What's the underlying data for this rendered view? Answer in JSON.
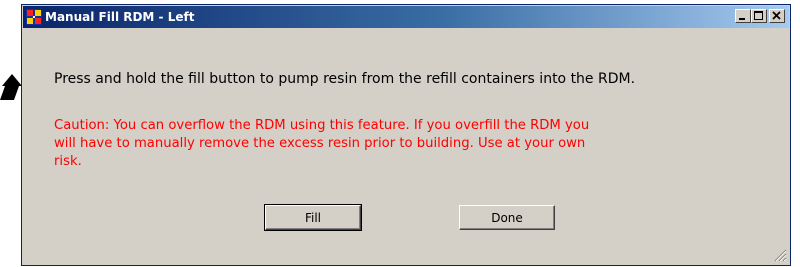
{
  "window": {
    "title": "Manual Fill RDM - Left",
    "title_bar_color": "#0a246a",
    "background_color": "#d4d0c8",
    "icon": "app-window-icon",
    "caption_buttons": {
      "minimize_icon": "minimize-icon",
      "maximize_icon": "maximize-icon",
      "close_icon": "close-icon"
    }
  },
  "dialog": {
    "instruction": "Press and hold the fill button to pump resin from the refill containers into the RDM.",
    "caution_lines": [
      "Caution: You can overflow the RDM using this feature.  If you overfill the RDM you",
      "will have to manually remove the excess resin prior to building. Use at your own",
      "risk."
    ],
    "caution_color": "#ff0000",
    "fill_label": "Fill",
    "done_label": "Done"
  },
  "annotation": {
    "arrow_icon": "pointer-arrow-icon"
  }
}
